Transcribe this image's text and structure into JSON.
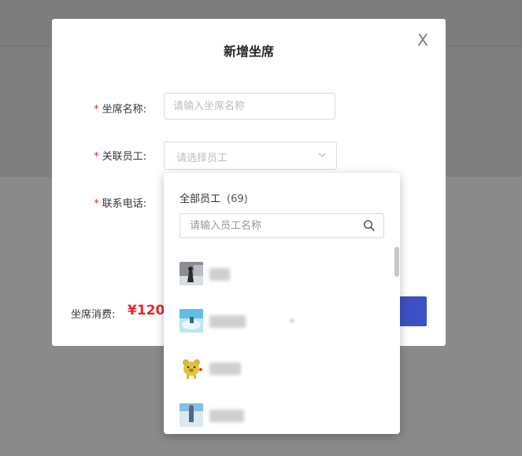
{
  "modal": {
    "title": "新增坐席",
    "close_glyph": "X",
    "fields": {
      "seat_name": {
        "label": "坐席名称:",
        "placeholder": "请输入坐席名称",
        "value": ""
      },
      "employee": {
        "label": "关联员工:",
        "placeholder": "请选择员工"
      },
      "phone": {
        "label": "联系电话:"
      }
    },
    "required_mark": "*",
    "cost_label": "坐席消费:",
    "cost_value": "¥120.",
    "accent_color": "#3d50c4",
    "price_color": "#e8262c"
  },
  "dropdown": {
    "header_label": "全部员工",
    "header_count": "(69)",
    "search_placeholder": "请输入员工名称",
    "search_icon": "search-icon",
    "employees": [
      {
        "name": "",
        "avatar": "person-photo-avatar"
      },
      {
        "name": "",
        "avatar": "sky-photo-avatar"
      },
      {
        "name": "",
        "avatar": "yellow-bear-avatar"
      },
      {
        "name": "",
        "avatar": "person-photo-avatar"
      }
    ]
  }
}
